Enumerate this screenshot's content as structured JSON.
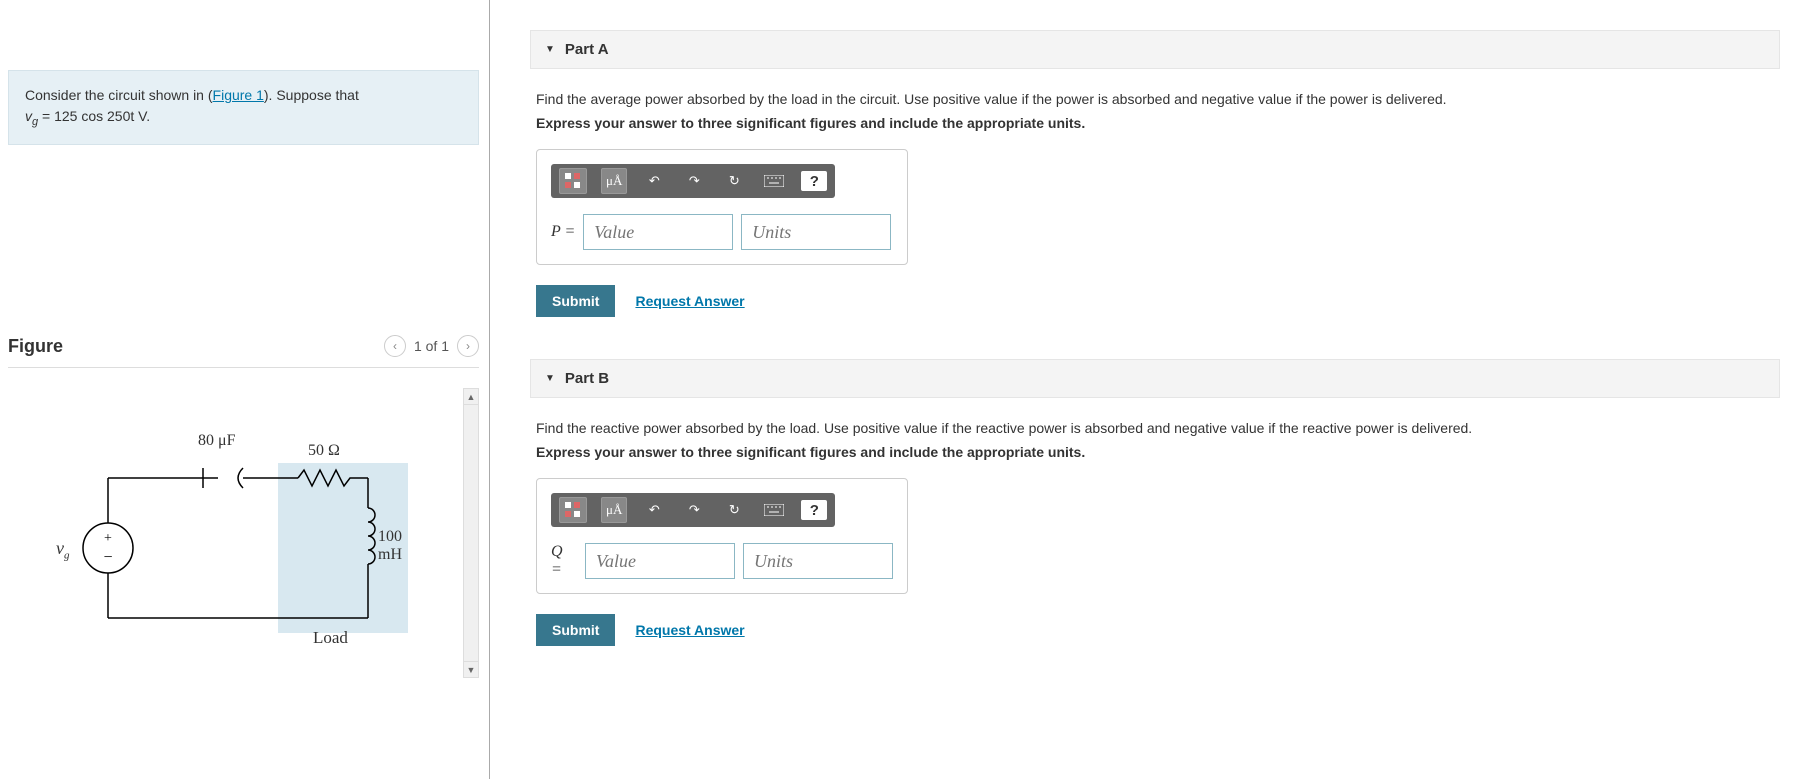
{
  "problem": {
    "prefix": "Consider the circuit shown in (",
    "link": "Figure 1",
    "mid": "). Suppose that ",
    "equation_lhs": "v",
    "equation_sub": "g",
    "equation_rhs": " = 125 cos 250t V."
  },
  "figure": {
    "title": "Figure",
    "nav": "1 of 1",
    "labels": {
      "cap": "80 μF",
      "res": "50 Ω",
      "ind": "100 mH",
      "src": "v",
      "src_sub": "g",
      "load": "Load"
    }
  },
  "partA": {
    "header": "Part A",
    "prompt1": "Find the average power absorbed by the load in the circuit. Use positive value if the power is absorbed and negative value if the power is delivered.",
    "prompt2": "Express your answer to three significant figures and include the appropriate units.",
    "symbol": "P =",
    "value_ph": "Value",
    "units_ph": "Units",
    "submit": "Submit",
    "request": "Request Answer"
  },
  "partB": {
    "header": "Part B",
    "prompt1": "Find the reactive power absorbed by the load. Use positive value if the reactive power is absorbed and negative value if the reactive power is delivered.",
    "prompt2": "Express your answer to three significant figures and include the appropriate units.",
    "symbol": "Q =",
    "value_ph": "Value",
    "units_ph": "Units",
    "submit": "Submit",
    "request": "Request Answer"
  },
  "toolbar": {
    "units_btn": "μÅ"
  }
}
